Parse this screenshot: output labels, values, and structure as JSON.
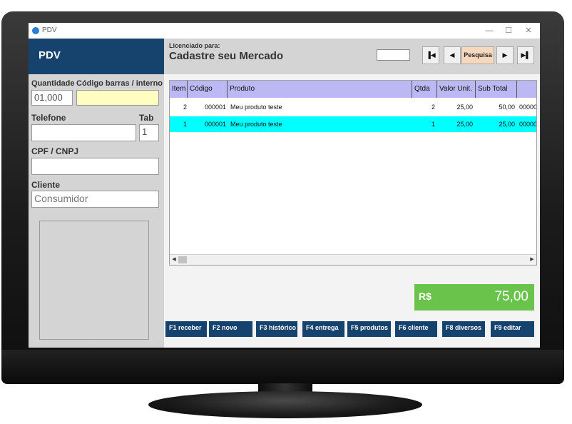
{
  "window": {
    "title": "PDV",
    "minimize": "—",
    "maximize": "☐",
    "close": "✕"
  },
  "left": {
    "header": "PDV",
    "quantidade_label": "Quantidade",
    "quantidade_value": "01,000",
    "codigo_label": "Código barras / interno",
    "codigo_value": "",
    "telefone_label": "Telefone",
    "telefone_value": "",
    "tab_label": "Tab",
    "tab_value": "1",
    "cpf_label": "CPF / CNPJ",
    "cpf_value": "",
    "cliente_label": "Cliente",
    "cliente_value": "Consumidor"
  },
  "top": {
    "licenciado_label": "Licenciado para:",
    "licenciado_name": "Cadastre seu Mercado",
    "page_value": "",
    "nav": {
      "first": "▐◀",
      "prev": "◀",
      "search": "Pesquisa",
      "next": "▶",
      "last": "▶▌"
    }
  },
  "grid": {
    "columns": [
      "Item",
      "Código",
      "Produto",
      "Qtda",
      "Valor Unit.",
      "Sub Total",
      ""
    ],
    "rows": [
      {
        "item": "2",
        "codigo": "000001",
        "produto": "Meu produto teste",
        "qtda": "2",
        "valor": "25,00",
        "subtotal": "50,00",
        "extra": "00000"
      },
      {
        "item": "1",
        "codigo": "000001",
        "produto": "Meu produto teste",
        "qtda": "1",
        "valor": "25,00",
        "subtotal": "25,00",
        "extra": "00000"
      }
    ],
    "scroll_left": "◀",
    "scroll_right": "▶"
  },
  "total": {
    "currency": "R$",
    "amount": "75,00"
  },
  "fkeys": [
    "F1 receber",
    "F2 novo",
    "F3 histórico",
    "F4 entrega",
    "F5 produtos",
    "F6 cliente",
    "F8 diversos",
    "F9 editar"
  ],
  "colors": {
    "header_blue": "#16426e",
    "grid_header": "#bbb8f3",
    "selected_row": "#00ffff",
    "total_green": "#6ac44c",
    "search_button": "#f6d9bd",
    "barcode_field": "#fffdc0"
  }
}
